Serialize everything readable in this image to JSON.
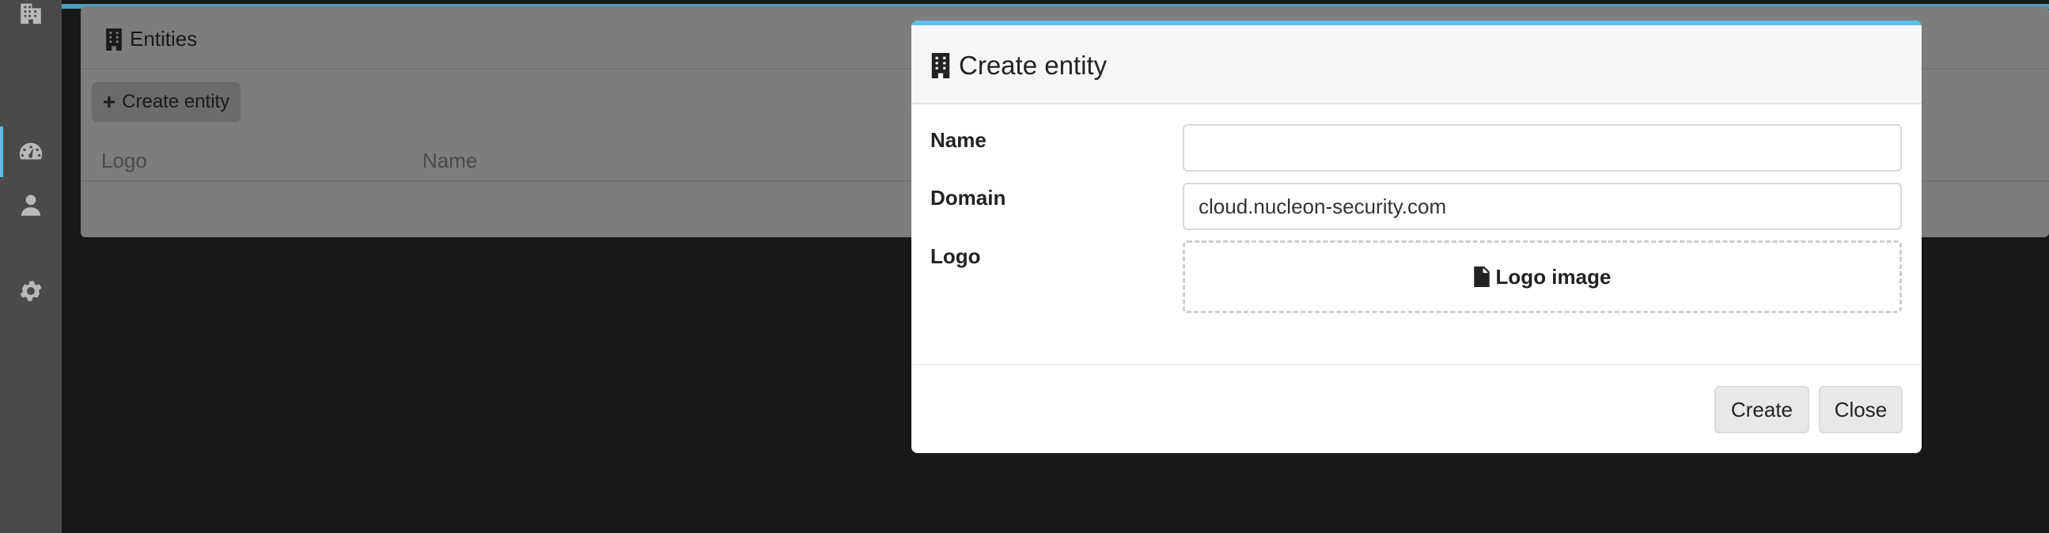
{
  "sidebar": {
    "items": [
      {
        "icon": "building-icon"
      },
      {
        "icon": "dashboard-icon",
        "active": true
      },
      {
        "icon": "user-icon"
      },
      {
        "icon": "gear-icon"
      }
    ],
    "accent_color": "#5bc0eb"
  },
  "page": {
    "title": "Entities",
    "create_button_label": "Create entity",
    "columns": [
      "Logo",
      "Name"
    ]
  },
  "modal": {
    "title": "Create entity",
    "fields": {
      "name": {
        "label": "Name",
        "value": ""
      },
      "domain": {
        "label": "Domain",
        "value": "cloud.nucleon-security.com"
      },
      "logo": {
        "label": "Logo",
        "dropzone_label": "Logo image"
      }
    },
    "buttons": {
      "create": "Create",
      "close": "Close"
    }
  }
}
